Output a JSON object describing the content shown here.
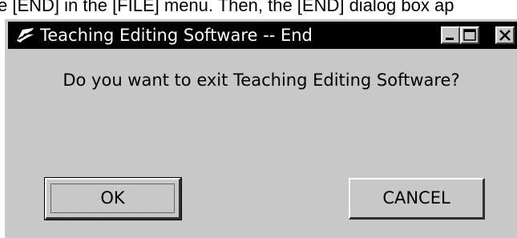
{
  "doc": {
    "text": "e [END] in the [FILE] menu. Then, the [END] dialog box ap"
  },
  "window": {
    "title": "Teaching Editing Software -- End",
    "controls": {
      "minimize": "minimize-icon",
      "maximize": "maximize-icon",
      "close": "close-icon"
    }
  },
  "dialog": {
    "message": "Do you want to exit Teaching Editing Software?",
    "ok_label": "OK",
    "cancel_label": "CANCEL"
  },
  "colors": {
    "face": "#c8c8c8",
    "titlebar": "#000000",
    "title_text": "#ffffff"
  }
}
